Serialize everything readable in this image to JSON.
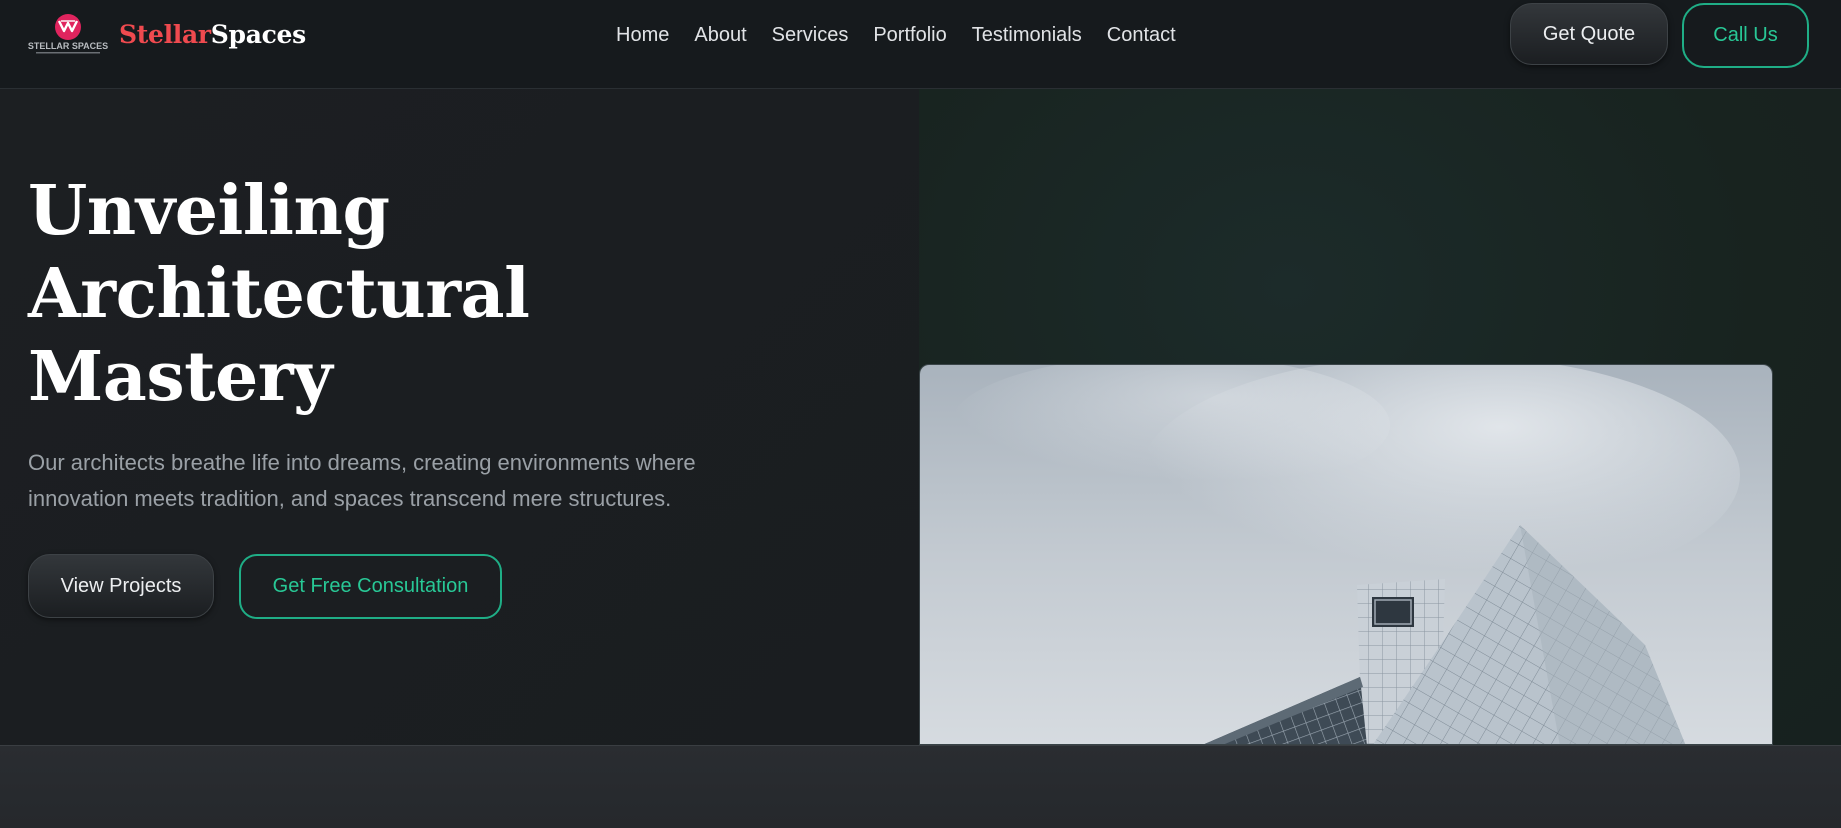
{
  "header": {
    "logo_text": "STELLAR SPACES",
    "brand_part1": "Stellar",
    "brand_part2": "Spaces",
    "nav": [
      "Home",
      "About",
      "Services",
      "Portfolio",
      "Testimonials",
      "Contact"
    ],
    "get_quote_label": "Get Quote",
    "call_us_label": "Call Us"
  },
  "hero": {
    "headline_lines": [
      "Unveiling",
      "Architectural",
      "Mastery"
    ],
    "subtext": "Our architects breathe life into dreams, creating environments where innovation meets tradition, and spaces transcend mere structures.",
    "view_projects_label": "View Projects",
    "consultation_label": "Get Free Consultation",
    "image_icon": "modern-building-photo"
  },
  "colors": {
    "brand_red": "#ef4a4f",
    "accent_green": "#28c896",
    "background": "#1b1e21"
  }
}
